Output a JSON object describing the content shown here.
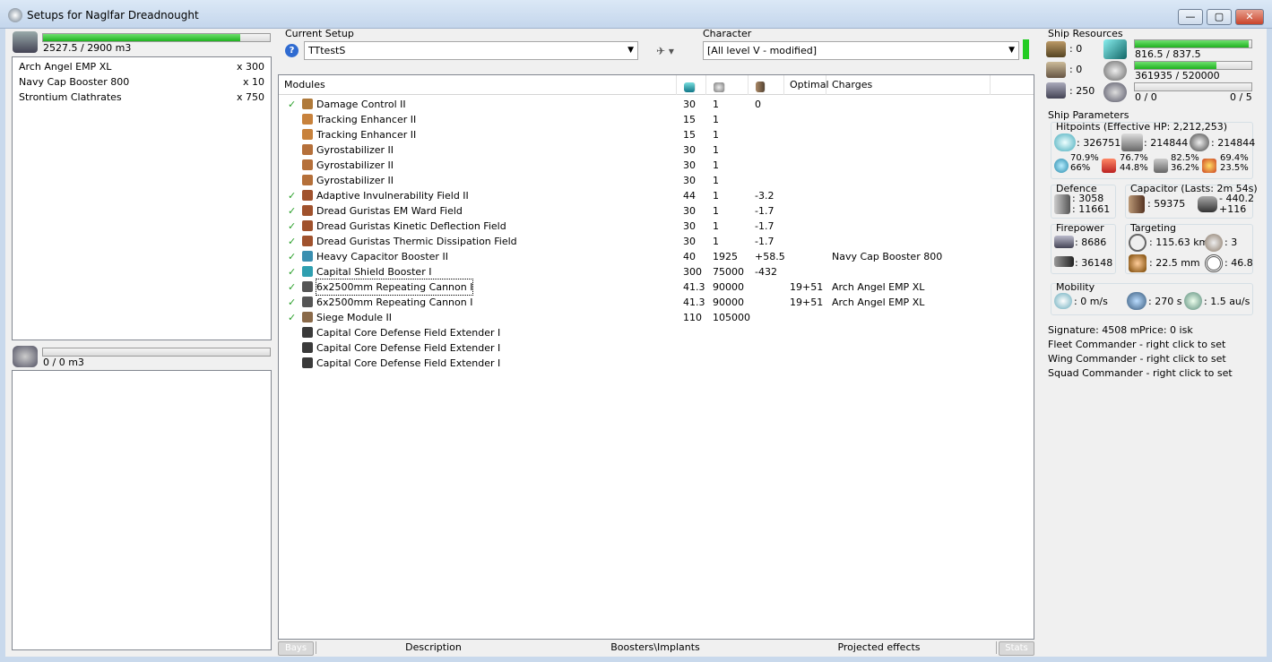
{
  "window": {
    "title": "Setups for Naglfar Dreadnought",
    "minimize": "—",
    "maximize": "▢",
    "close": "✕"
  },
  "cargo": {
    "capacity_text": "2527.5 / 2900 m3",
    "fill_fraction": 0.87,
    "items": [
      {
        "name": "Arch Angel EMP XL",
        "qty": "x 300"
      },
      {
        "name": "Navy Cap Booster 800",
        "qty": "x 10"
      },
      {
        "name": "Strontium Clathrates",
        "qty": "x 750"
      }
    ]
  },
  "drones": {
    "capacity_text": "0 / 0 m3",
    "fill_fraction": 0
  },
  "setup": {
    "label": "Current Setup",
    "value": "TTtestS",
    "help_icon": "help-icon"
  },
  "character": {
    "label": "Character",
    "value": "[All level V - modified]",
    "status_color": "#22cc22"
  },
  "modules": {
    "headers": {
      "name": "Modules",
      "optimal": "Optimal",
      "charges": "Charges"
    },
    "rows": [
      {
        "active": true,
        "name": "Damage Control II",
        "cpu": "30",
        "pg": "1",
        "cap": "0",
        "optimal": "",
        "charge": "",
        "color": "#b07a3a"
      },
      {
        "active": false,
        "name": "Tracking Enhancer II",
        "cpu": "15",
        "pg": "1",
        "cap": "",
        "optimal": "",
        "charge": "",
        "color": "#c8823c"
      },
      {
        "active": false,
        "name": "Tracking Enhancer II",
        "cpu": "15",
        "pg": "1",
        "cap": "",
        "optimal": "",
        "charge": "",
        "color": "#c8823c"
      },
      {
        "active": false,
        "name": "Gyrostabilizer II",
        "cpu": "30",
        "pg": "1",
        "cap": "",
        "optimal": "",
        "charge": "",
        "color": "#b5703a"
      },
      {
        "active": false,
        "name": "Gyrostabilizer II",
        "cpu": "30",
        "pg": "1",
        "cap": "",
        "optimal": "",
        "charge": "",
        "color": "#b5703a"
      },
      {
        "active": false,
        "name": "Gyrostabilizer II",
        "cpu": "30",
        "pg": "1",
        "cap": "",
        "optimal": "",
        "charge": "",
        "color": "#b5703a"
      },
      {
        "active": true,
        "name": "Adaptive Invulnerability Field II",
        "cpu": "44",
        "pg": "1",
        "cap": "-3.2",
        "optimal": "",
        "charge": "",
        "color": "#a0522d"
      },
      {
        "active": true,
        "name": "Dread Guristas EM Ward Field",
        "cpu": "30",
        "pg": "1",
        "cap": "-1.7",
        "optimal": "",
        "charge": "",
        "color": "#a0522d"
      },
      {
        "active": true,
        "name": "Dread Guristas Kinetic Deflection Field",
        "cpu": "30",
        "pg": "1",
        "cap": "-1.7",
        "optimal": "",
        "charge": "",
        "color": "#a0522d"
      },
      {
        "active": true,
        "name": "Dread Guristas Thermic Dissipation Field",
        "cpu": "30",
        "pg": "1",
        "cap": "-1.7",
        "optimal": "",
        "charge": "",
        "color": "#a0522d"
      },
      {
        "active": true,
        "name": "Heavy Capacitor Booster II",
        "cpu": "40",
        "pg": "1925",
        "cap": "+58.5",
        "optimal": "",
        "charge": "Navy Cap Booster 800",
        "color": "#3a8fb0"
      },
      {
        "active": true,
        "name": "Capital Shield Booster I",
        "cpu": "300",
        "pg": "75000",
        "cap": "-432",
        "optimal": "",
        "charge": "",
        "color": "#2f9fb0"
      },
      {
        "active": true,
        "name": "6x2500mm Repeating Cannon I",
        "cpu": "41.3",
        "pg": "90000",
        "cap": "",
        "optimal": "19+51",
        "charge": "Arch Angel EMP XL",
        "color": "#555555"
      },
      {
        "active": true,
        "name": "6x2500mm Repeating Cannon I",
        "cpu": "41.3",
        "pg": "90000",
        "cap": "",
        "optimal": "19+51",
        "charge": "Arch Angel EMP XL",
        "color": "#555555"
      },
      {
        "active": true,
        "name": "Siege Module II",
        "cpu": "110",
        "pg": "105000",
        "cap": "",
        "optimal": "",
        "charge": "",
        "color": "#8a6a4a"
      },
      {
        "active": false,
        "name": "Capital Core Defense Field Extender I",
        "cpu": "",
        "pg": "",
        "cap": "",
        "optimal": "",
        "charge": "",
        "color": "#3a3a3a"
      },
      {
        "active": false,
        "name": "Capital Core Defense Field Extender I",
        "cpu": "",
        "pg": "",
        "cap": "",
        "optimal": "",
        "charge": "",
        "color": "#3a3a3a"
      },
      {
        "active": false,
        "name": "Capital Core Defense Field Extender I",
        "cpu": "",
        "pg": "",
        "cap": "",
        "optimal": "",
        "charge": "",
        "color": "#3a3a3a"
      }
    ]
  },
  "bottom_tabs": {
    "bays": "Bays",
    "description": "Description",
    "boosters": "Boosters\\Implants",
    "projected": "Projected effects",
    "stats": "Stats"
  },
  "resources": {
    "title": "Ship Resources",
    "hi": ": 0",
    "med": ": 0",
    "calib": ": 250",
    "cpu_text": "816.5 / 837.5",
    "cpu_fraction": 0.975,
    "pg_text": "361935 / 520000",
    "pg_fraction": 0.7,
    "drone_text": "0 / 0",
    "drone_slots": "0 / 5",
    "drone_fraction": 0
  },
  "params": {
    "title": "Ship Parameters",
    "hitpoints_title": "Hitpoints (Effective HP: 2,212,253)",
    "shield_hp": ": 326751",
    "armor_hp": ": 214844",
    "hull_hp": ": 214844",
    "res_em": [
      "70.9%",
      "66%"
    ],
    "res_thermal": [
      "76.7%",
      "44.8%"
    ],
    "res_kinetic": [
      "82.5%",
      "36.2%"
    ],
    "res_explosive": [
      "69.4%",
      "23.5%"
    ],
    "defence_title": "Defence",
    "defence_a": ": 3058",
    "defence_b": ": 11661",
    "capacitor_title": "Capacitor (Lasts: 2m 54s)",
    "cap_amount": ": 59375",
    "cap_delta_a": "- 440.2",
    "cap_delta_b": "+116",
    "firepower_title": "Firepower",
    "fire_a": ": 8686",
    "fire_b": ": 36148",
    "targeting_title": "Targeting",
    "target_range": ": 115.63 km",
    "target_count": ": 3",
    "target_res": ": 22.5 mm",
    "target_sensor": ": 46.8",
    "mobility_title": "Mobility",
    "speed": ": 0 m/s",
    "align": ": 270 s",
    "warp": ": 1.5 au/s",
    "signature": "Signature: 4508 m",
    "price": "Price: 0 isk",
    "fleet": "Fleet Commander - right click to set",
    "wing": "Wing Commander - right click to set",
    "squad": "Squad Commander - right click to set"
  }
}
